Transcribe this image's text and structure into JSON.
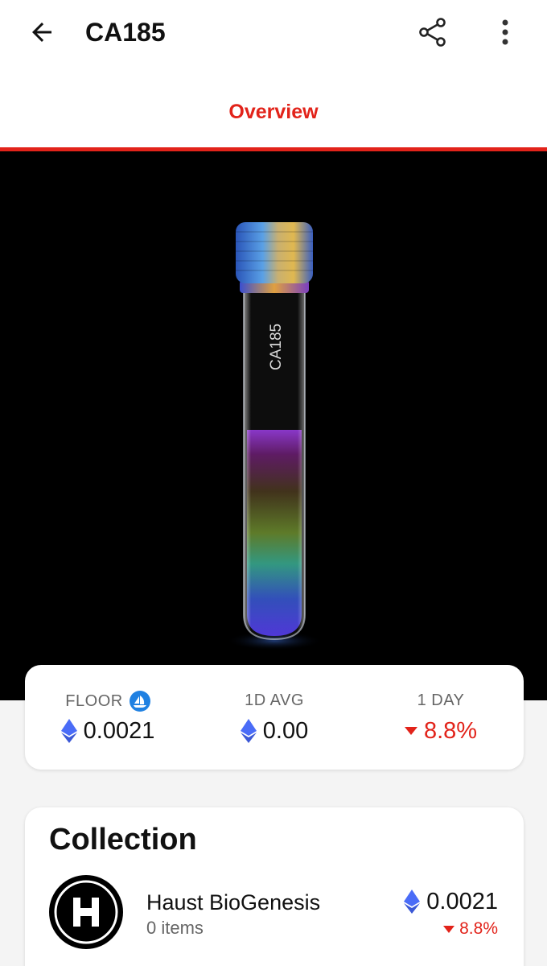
{
  "header": {
    "title": "CA185",
    "back_icon": "arrow-left-icon",
    "share_icon": "share-icon",
    "more_icon": "more-vertical-icon"
  },
  "tabs": [
    {
      "label": "Overview",
      "active": true
    }
  ],
  "hero": {
    "tube_label": "CA185",
    "background": "#000000"
  },
  "stats": [
    {
      "label": "FLOOR",
      "value": "0.0021",
      "currency_icon": "eth-icon",
      "source_icon": "opensea-icon"
    },
    {
      "label": "1D AVG",
      "value": "0.00",
      "currency_icon": "eth-icon"
    },
    {
      "label": "1 DAY",
      "value": "8.8%",
      "trend": "down"
    }
  ],
  "collection": {
    "heading": "Collection",
    "name": "Haust BioGenesis",
    "items": "0 items",
    "price": "0.0021",
    "change": "8.8%",
    "change_trend": "down",
    "avatar_icon": "haust-logo-icon"
  },
  "colors": {
    "accent": "#e2231a",
    "eth": "#4a6cf7",
    "opensea": "#2081e2"
  }
}
